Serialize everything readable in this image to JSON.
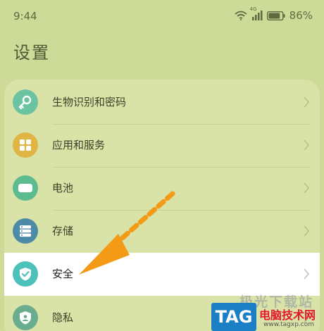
{
  "status_bar": {
    "time": "9:44",
    "signal_badge": "4G",
    "battery_percent": "86%",
    "battery_level": 0.86
  },
  "page": {
    "title": "设置"
  },
  "settings": {
    "items": [
      {
        "label": "生物识别和密码",
        "icon": "key-icon",
        "color": "#6cc3a2"
      },
      {
        "label": "应用和服务",
        "icon": "apps-grid-icon",
        "color": "#e0b544"
      },
      {
        "label": "电池",
        "icon": "battery-icon",
        "color": "#5cbc8f"
      },
      {
        "label": "存储",
        "icon": "storage-icon",
        "color": "#4d8aa6"
      },
      {
        "label": "安全",
        "icon": "shield-check-icon",
        "color": "#4ec2ba"
      },
      {
        "label": "隐私",
        "icon": "privacy-shield-icon",
        "color": "#6aad8e"
      }
    ]
  },
  "watermark": {
    "badge": "TAG",
    "faded_text": "极光下载站",
    "cn_text": "电脑技术网",
    "url": "www.tagxp.com"
  },
  "colors": {
    "background": "#cedb98",
    "card": "#d9e3a7",
    "highlight": "#ffffff",
    "arrow": "#f39a17",
    "tag_blue": "#1b7fc6",
    "watermark_red": "#e5172b"
  }
}
